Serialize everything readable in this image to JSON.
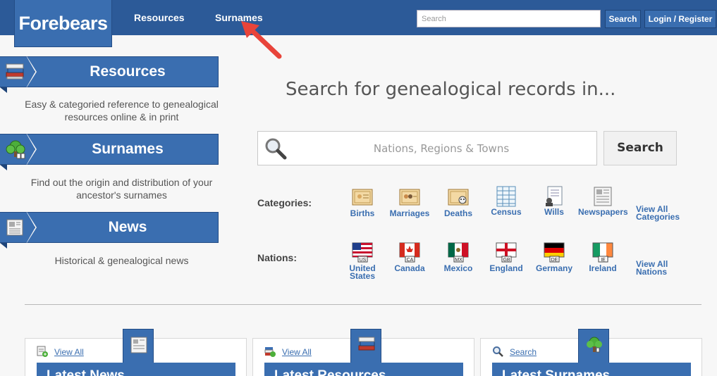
{
  "header": {
    "logo": "Forebears",
    "nav": [
      {
        "label": "Resources"
      },
      {
        "label": "Surnames"
      }
    ],
    "search_placeholder": "Search",
    "search_button": "Search",
    "login_button": "Login / Register"
  },
  "sidebar": [
    {
      "title": "Resources",
      "description": "Easy & categoried reference to genealogical resources online & in print",
      "icon": "book-icon"
    },
    {
      "title": "Surnames",
      "description": "Find out the origin and distribution of your ancestor's surnames",
      "icon": "family-tree-icon"
    },
    {
      "title": "News",
      "description": "Historical & genealogical news",
      "icon": "newspaper-icon"
    }
  ],
  "main": {
    "headline": "Search for genealogical records in...",
    "search_placeholder": "Nations, Regions & Towns",
    "search_button": "Search",
    "categories_label": "Categories:",
    "categories": [
      {
        "label": "Births",
        "icon": "birth-certificate-icon"
      },
      {
        "label": "Marriages",
        "icon": "marriage-certificate-icon"
      },
      {
        "label": "Deaths",
        "icon": "death-certificate-icon"
      },
      {
        "label": "Census",
        "icon": "census-sheet-icon"
      },
      {
        "label": "Wills",
        "icon": "will-document-icon"
      },
      {
        "label": "Newspapers",
        "icon": "newspaper-icon"
      }
    ],
    "categories_view_all": [
      "View All",
      "Categories"
    ],
    "nations_label": "Nations:",
    "nations": [
      {
        "label": [
          "United",
          "States"
        ],
        "code": "US",
        "icon": "us-flag-icon"
      },
      {
        "label": [
          "Canada"
        ],
        "code": "CA",
        "icon": "canada-flag-icon"
      },
      {
        "label": [
          "Mexico"
        ],
        "code": "MX",
        "icon": "mexico-flag-icon"
      },
      {
        "label": [
          "England"
        ],
        "code": "GB",
        "icon": "england-flag-icon"
      },
      {
        "label": [
          "Germany"
        ],
        "code": "DE",
        "icon": "germany-flag-icon"
      },
      {
        "label": [
          "Ireland"
        ],
        "code": "IE",
        "icon": "ireland-flag-icon"
      }
    ],
    "nations_view_all": [
      "View All",
      "Nations"
    ]
  },
  "cards": [
    {
      "link": "View All",
      "title": "Latest News",
      "icon": "newspaper-icon"
    },
    {
      "link": "View All",
      "title": "Latest Resources",
      "icon": "book-icon"
    },
    {
      "link": "Search",
      "title": "Latest Surnames",
      "icon": "family-tree-icon"
    }
  ],
  "colors": {
    "primary": "#2c5a98",
    "accent": "#3a6eb0",
    "annotation": "#e8443a",
    "background": "#f7f7f7"
  }
}
